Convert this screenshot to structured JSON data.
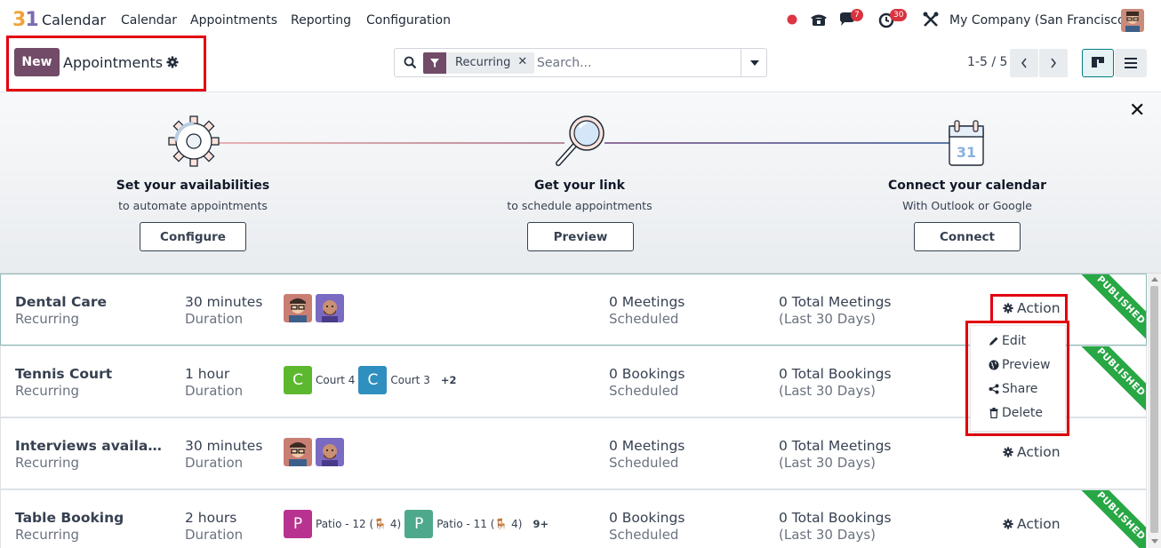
{
  "navbar": {
    "app_logo": "31",
    "app_name": "Calendar",
    "menu": [
      "Calendar",
      "Appointments",
      "Reporting",
      "Configuration"
    ],
    "messages_badge": "7",
    "activities_badge": "30",
    "company": "My Company (San Francisco)"
  },
  "control": {
    "new_label": "New",
    "title": "Appointments",
    "facet": "Recurring",
    "facet_remove": "✕",
    "search_placeholder": "Search...",
    "pager": "1-5 / 5"
  },
  "onboarding": {
    "close": "✕",
    "steps": [
      {
        "title": "Set your availabilities",
        "subtitle": "to automate appointments",
        "button": "Configure"
      },
      {
        "title": "Get your link",
        "subtitle": "to schedule appointments",
        "button": "Preview"
      },
      {
        "title": "Connect your calendar",
        "subtitle": "With Outlook or Google",
        "button": "Connect"
      }
    ]
  },
  "cards": [
    {
      "name": "Dental Care",
      "type": "Recurring",
      "duration": "30 minutes",
      "duration_label": "Duration",
      "stat1": "0 Meetings",
      "stat1_label": "Scheduled",
      "stat2": "0 Total Meetings",
      "stat2_label": "(Last 30 Days)",
      "action": "Action",
      "ribbon": "PUBLISHED"
    },
    {
      "name": "Tennis Court",
      "type": "Recurring",
      "duration": "1 hour",
      "duration_label": "Duration",
      "resources": [
        {
          "initial": "C",
          "label": "Court 4",
          "color": "#5cb82e"
        },
        {
          "initial": "C",
          "label": "Court 3",
          "color": "#2f8fbf"
        }
      ],
      "more": "+2",
      "stat1": "0 Bookings",
      "stat1_label": "Scheduled",
      "stat2": "0 Total Bookings",
      "stat2_label": "(Last 30 Days)",
      "ribbon": "PUBLISHED"
    },
    {
      "name": "Interviews availab…",
      "type": "Recurring",
      "duration": "30 minutes",
      "duration_label": "Duration",
      "stat1": "0 Meetings",
      "stat1_label": "Scheduled",
      "stat2": "0 Total Meetings",
      "stat2_label": "(Last 30 Days)",
      "action": "Action"
    },
    {
      "name": "Table Booking",
      "type": "Recurring",
      "duration": "2 hours",
      "duration_label": "Duration",
      "resources": [
        {
          "initial": "P",
          "label": "Patio - 12 (🪑 4)",
          "color": "#b8338f"
        },
        {
          "initial": "P",
          "label": "Patio - 11 (🪑 4)",
          "color": "#4ea88c"
        }
      ],
      "more": "9+",
      "stat1": "0 Bookings",
      "stat1_label": "Scheduled",
      "stat2": "0 Total Bookings",
      "stat2_label": "(Last 30 Days)",
      "action": "Action",
      "ribbon": "PUBLISHED"
    }
  ],
  "dropdown": {
    "items": [
      "Edit",
      "Preview",
      "Share",
      "Delete"
    ]
  },
  "colors": {
    "brand": "#714b67",
    "highlight": "#e3000f",
    "published": "#28a745"
  }
}
